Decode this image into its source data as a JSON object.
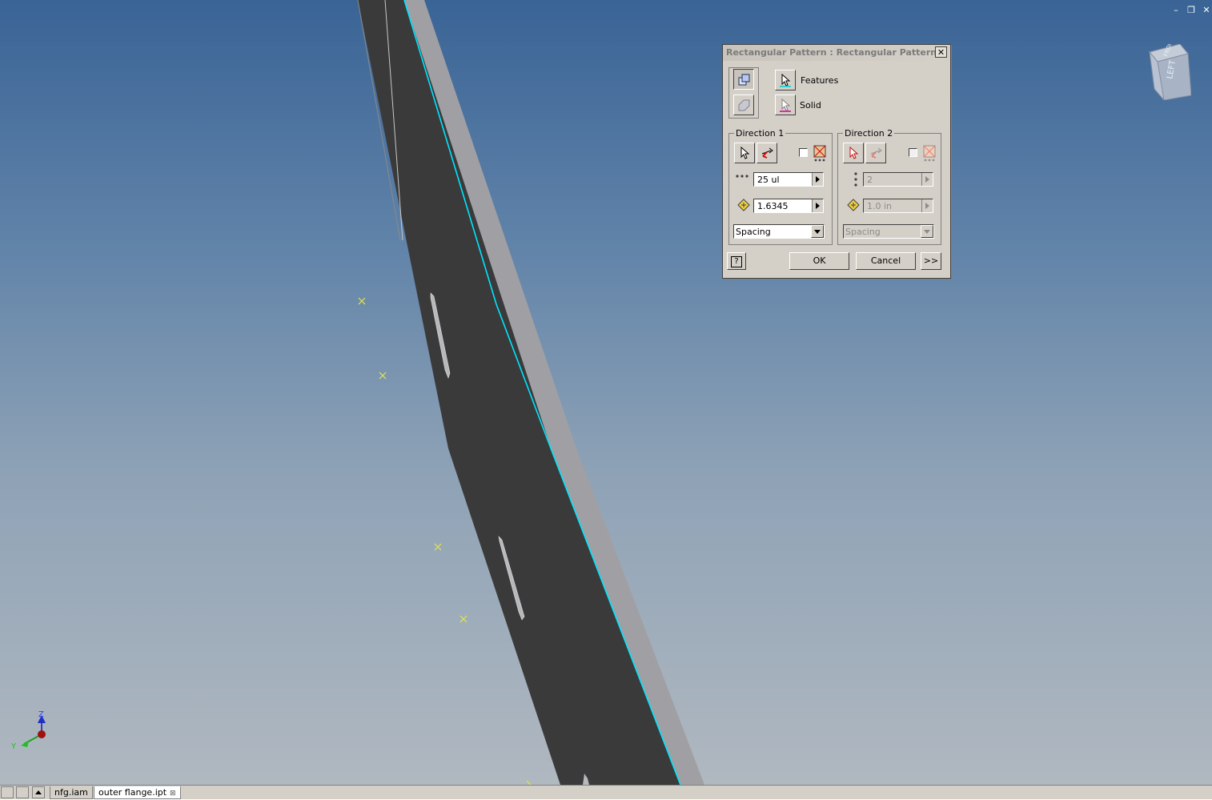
{
  "window": {
    "controls": {
      "minimize": "–",
      "restore": "❐",
      "close": "✕"
    },
    "viewcube_face": "LEFT",
    "viewcube_top": "FRONT",
    "triad": {
      "z": "Z",
      "y": "Y"
    }
  },
  "dialog": {
    "title": "Rectangular Pattern : Rectangular Pattern1",
    "close_label": "✕",
    "selection": {
      "features_label": "Features",
      "solid_label": "Solid"
    },
    "direction1": {
      "title": "Direction 1",
      "count_value": "25 ul",
      "spacing_value": "1.6345",
      "method_value": "Spacing"
    },
    "direction2": {
      "title": "Direction 2",
      "count_value": "2",
      "spacing_value": "1.0 in",
      "method_value": "Spacing"
    },
    "buttons": {
      "help_label": "?",
      "ok_label": "OK",
      "cancel_label": "Cancel",
      "more_label": ">>"
    }
  },
  "tabs": {
    "items": [
      {
        "label": "nfg.iam"
      },
      {
        "label": "outer flange.ipt"
      }
    ],
    "close_glyph": "⊠"
  },
  "colors": {
    "part_dark": "#3a3a3a",
    "part_edge": "#a0a0a4",
    "highlight_edge": "#00e5ff",
    "sketch_point": "#e6e64a",
    "background_top": "#3a6496",
    "background_bottom": "#b0b8c0"
  }
}
